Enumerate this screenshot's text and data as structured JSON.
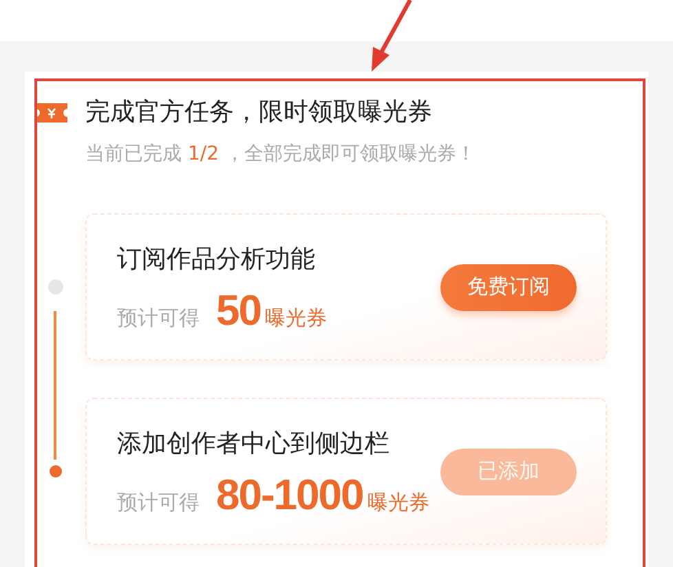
{
  "header": {
    "title": "完成官方任务，限时领取曝光券",
    "progress_prefix": "当前已完成",
    "progress": "1/2",
    "progress_suffix": "，全部完成即可领取曝光券！"
  },
  "tasks": [
    {
      "title": "订阅作品分析功能",
      "reward_label": "预计可得",
      "reward_amount": "50",
      "reward_unit": "曝光券",
      "button": "免费订阅",
      "done": false
    },
    {
      "title": "添加创作者中心到侧边栏",
      "reward_label": "预计可得",
      "reward_amount": "80-1000",
      "reward_unit": "曝光券",
      "button": "已添加",
      "done": true
    }
  ]
}
